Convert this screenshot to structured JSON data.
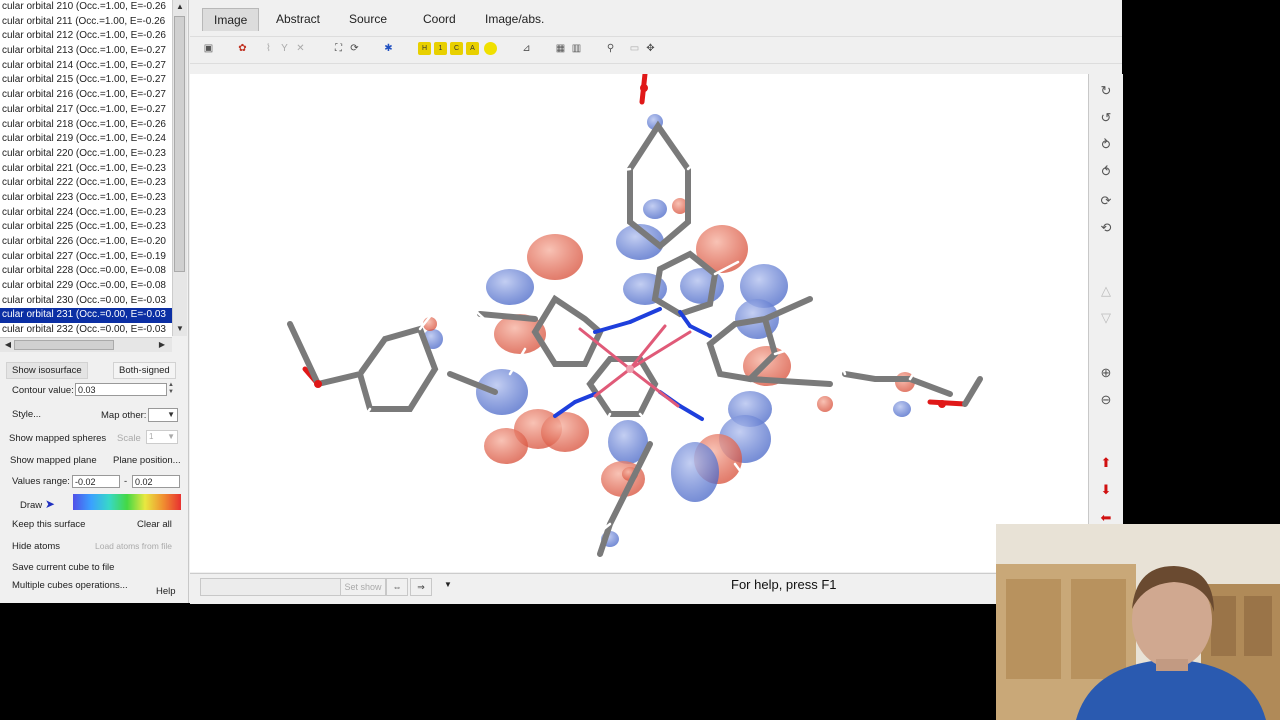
{
  "orbitals": [
    "cular orbital  210 (Occ.=1.00, E=-0.26",
    "cular orbital  211 (Occ.=1.00, E=-0.26",
    "cular orbital  212 (Occ.=1.00, E=-0.26",
    "cular orbital  213 (Occ.=1.00, E=-0.27",
    "cular orbital  214 (Occ.=1.00, E=-0.27",
    "cular orbital  215 (Occ.=1.00, E=-0.27",
    "cular orbital  216 (Occ.=1.00, E=-0.27",
    "cular orbital  217 (Occ.=1.00, E=-0.27",
    "cular orbital  218 (Occ.=1.00, E=-0.26",
    "cular orbital  219 (Occ.=1.00, E=-0.24",
    "cular orbital  220 (Occ.=1.00, E=-0.23",
    "cular orbital  221 (Occ.=1.00, E=-0.23",
    "cular orbital  222 (Occ.=1.00, E=-0.23",
    "cular orbital  223 (Occ.=1.00, E=-0.23",
    "cular orbital  224 (Occ.=1.00, E=-0.23",
    "cular orbital  225 (Occ.=1.00, E=-0.23",
    "cular orbital  226 (Occ.=1.00, E=-0.20",
    "cular orbital  227 (Occ.=1.00, E=-0.19",
    "cular orbital  228 (Occ.=0.00, E=-0.08",
    "cular orbital  229 (Occ.=0.00, E=-0.08",
    "cular orbital  230 (Occ.=0.00, E=-0.03",
    "cular orbital  231 (Occ.=0.00, E=-0.03",
    "cular orbital  232 (Occ.=0.00, E=-0.03"
  ],
  "selected_index": 21,
  "left_panel": {
    "show_isosurface": "Show isosurface",
    "both_signed": "Both-signed",
    "contour_value_label": "Contour value:",
    "contour_value": "0.03",
    "style": "Style...",
    "map_other": "Map other:",
    "show_mapped_spheres": "Show mapped spheres",
    "scale": "Scale",
    "scale_value": "1",
    "show_mapped_plane": "Show mapped plane",
    "plane_position": "Plane position...",
    "values_range_label": "Values range:",
    "range_min": "-0.02",
    "range_sep": "-",
    "range_max": "0.02",
    "draw": "Draw",
    "keep_surface": "Keep this surface",
    "clear_all": "Clear all",
    "hide_atoms": "Hide atoms",
    "load_atoms": "Load atoms from file",
    "save_cube": "Save current cube to file",
    "multiple_cubes": "Multiple cubes operations...",
    "help": "Help"
  },
  "tabs": [
    "Image",
    "Abstract",
    "Source",
    "Coord",
    "Image/abs."
  ],
  "active_tab": "Image",
  "status": {
    "help_text": "For help, press F1",
    "set_show": "Set show"
  },
  "colors": {
    "selection": "#0b2fa4",
    "orbital_positive": "#e0533f",
    "orbital_negative": "#4a6fd0",
    "nitrogen": "#1e3fdc",
    "oxygen": "#e01818"
  }
}
